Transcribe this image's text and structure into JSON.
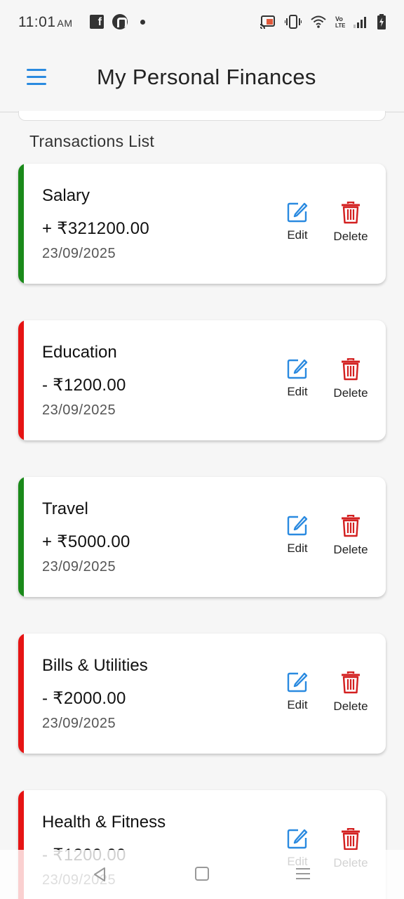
{
  "status_bar": {
    "time": "11:01",
    "ampm": "AM"
  },
  "app_bar": {
    "title": "My Personal Finances",
    "menu_icon": "hamburger-menu-icon"
  },
  "section": {
    "title": "Transactions List"
  },
  "actions": {
    "edit_label": "Edit",
    "delete_label": "Delete"
  },
  "colors": {
    "income": "#1a8a1a",
    "expense": "#e61414",
    "edit_icon": "#2a8ae0",
    "delete_icon": "#d32020"
  },
  "transactions": [
    {
      "category": "Salary",
      "amount": "+ ₹321200.00",
      "date": "23/09/2025",
      "type": "income"
    },
    {
      "category": "Education",
      "amount": "- ₹1200.00",
      "date": "23/09/2025",
      "type": "expense"
    },
    {
      "category": "Travel",
      "amount": "+ ₹5000.00",
      "date": "23/09/2025",
      "type": "income"
    },
    {
      "category": "Bills & Utilities",
      "amount": "- ₹2000.00",
      "date": "23/09/2025",
      "type": "expense"
    },
    {
      "category": "Health & Fitness",
      "amount": "- ₹1200.00",
      "date": "23/09/2025",
      "type": "expense"
    }
  ]
}
